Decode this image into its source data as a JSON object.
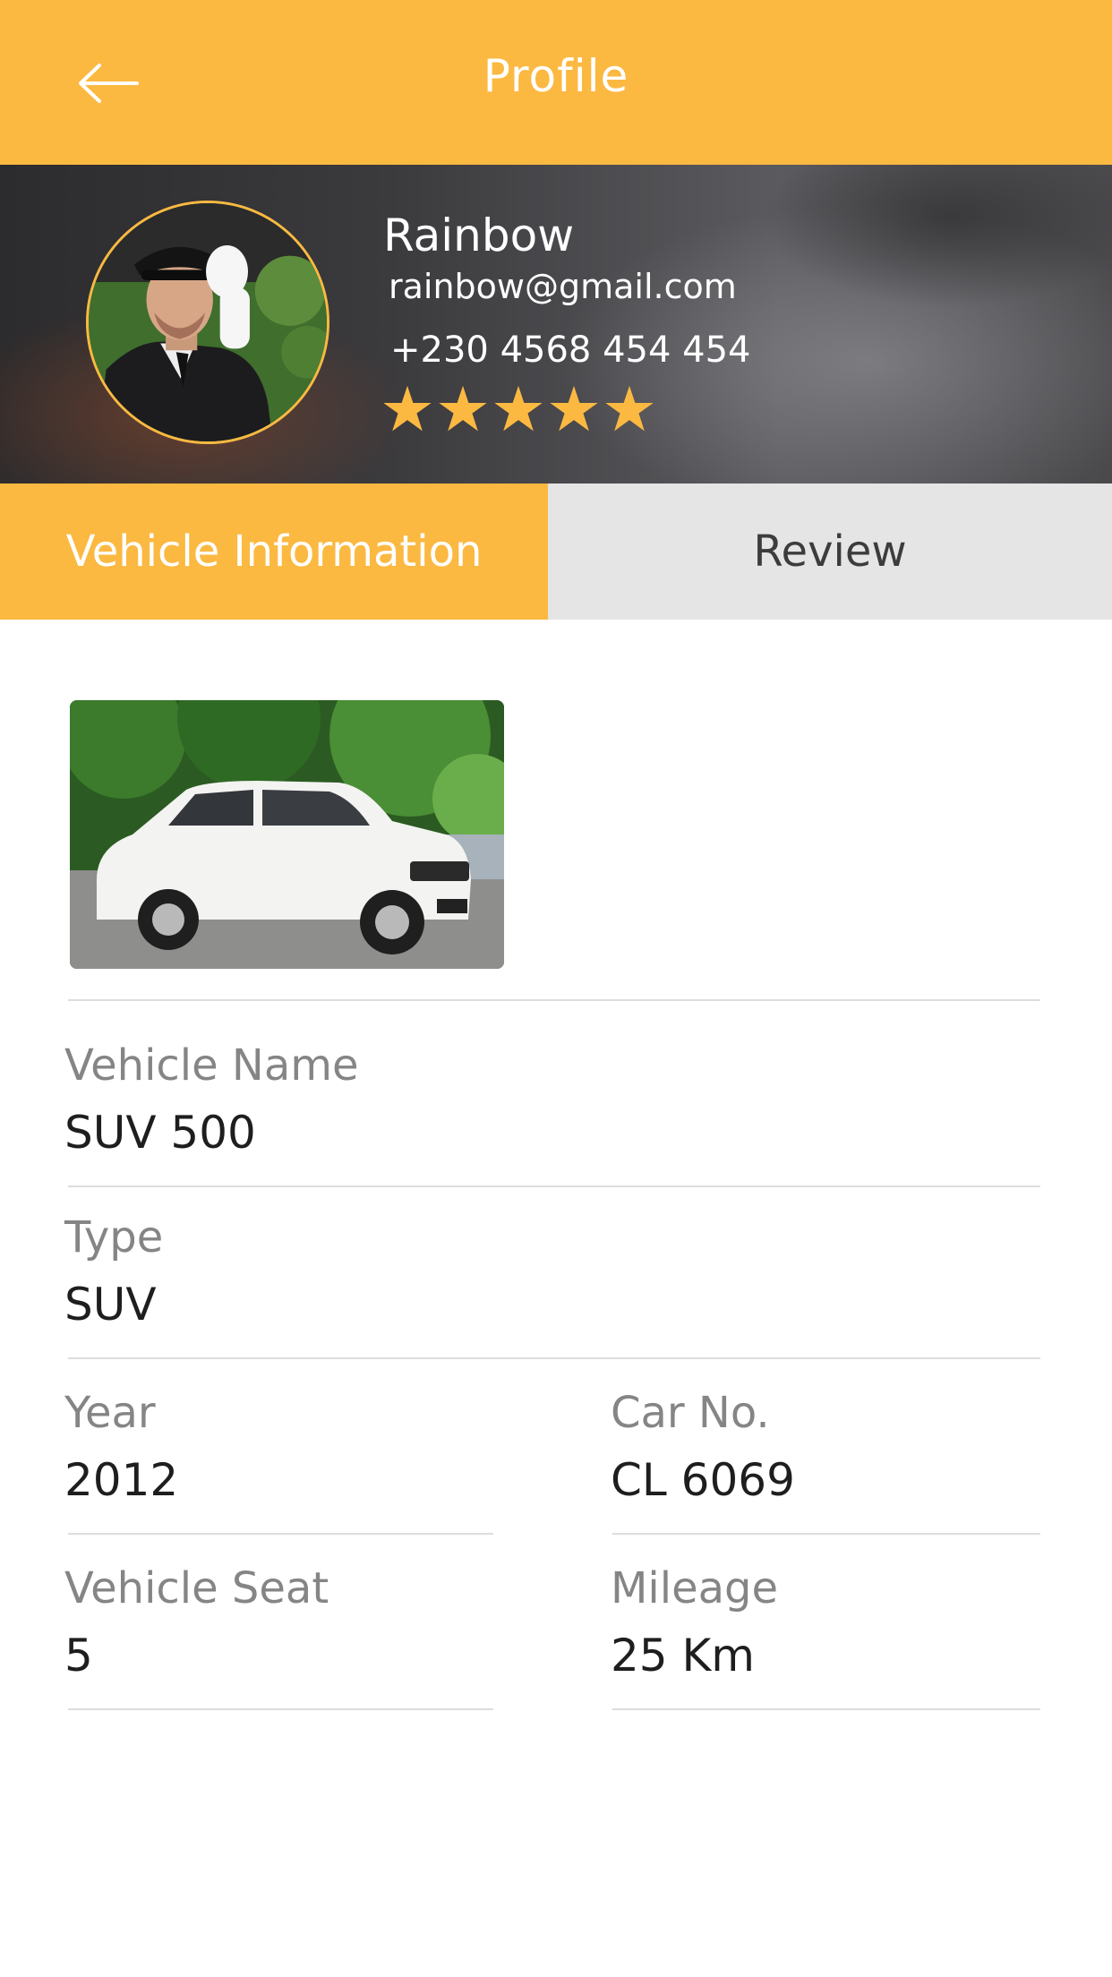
{
  "colors": {
    "accent": "#fbb942",
    "tab_inactive_bg": "#e5e5e5",
    "label": "#858585",
    "value": "#1e1e1e"
  },
  "header": {
    "back_icon": "arrow-left-icon",
    "title": "Profile"
  },
  "profile": {
    "name": "Rainbow",
    "email": "rainbow@gmail.com",
    "phone": "+230 4568 454 454",
    "rating": 5,
    "rating_icon": "star-icon"
  },
  "tabs": [
    {
      "label": "Vehicle Information",
      "active": true
    },
    {
      "label": "Review",
      "active": false
    }
  ],
  "vehicle": {
    "fields": {
      "name": {
        "label": "Vehicle Name",
        "value": "SUV 500"
      },
      "type": {
        "label": "Type",
        "value": "SUV"
      },
      "year": {
        "label": "Year",
        "value": "2012"
      },
      "car_no": {
        "label": "Car No.",
        "value": "CL 6069"
      },
      "seat": {
        "label": "Vehicle Seat",
        "value": "5"
      },
      "mileage": {
        "label": "Mileage",
        "value": "25 Km"
      }
    }
  }
}
